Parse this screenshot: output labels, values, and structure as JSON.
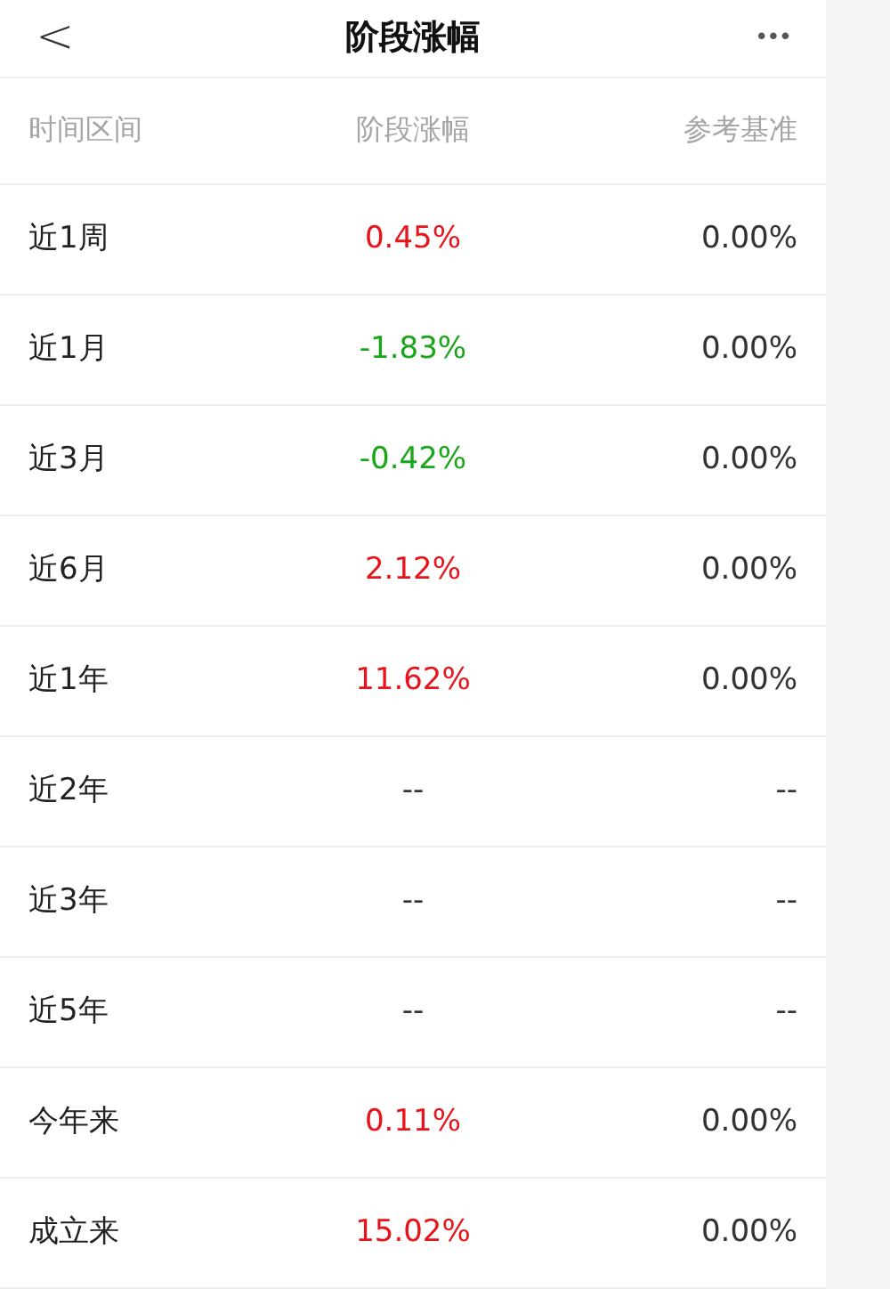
{
  "header": {
    "title": "阶段涨幅",
    "back_icon": "<",
    "more_icon": "•••"
  },
  "table": {
    "columns": [
      "时间区间",
      "阶段涨幅",
      "参考基准"
    ],
    "rows": [
      {
        "period": "近1周",
        "change": "0.45%",
        "color": "#e8141b",
        "benchmark": "0.00%"
      },
      {
        "period": "近1月",
        "change": "-1.83%",
        "color": "#1aa61a",
        "benchmark": "0.00%"
      },
      {
        "period": "近3月",
        "change": "-0.42%",
        "color": "#1aa61a",
        "benchmark": "0.00%"
      },
      {
        "period": "近6月",
        "change": "2.12%",
        "color": "#e8141b",
        "benchmark": "0.00%"
      },
      {
        "period": "近1年",
        "change": "11.62%",
        "color": "#e8141b",
        "benchmark": "0.00%"
      },
      {
        "period": "近2年",
        "change": "--",
        "color": "#333333",
        "benchmark": "--"
      },
      {
        "period": "近3年",
        "change": "--",
        "color": "#333333",
        "benchmark": "--"
      },
      {
        "period": "近5年",
        "change": "--",
        "color": "#333333",
        "benchmark": "--"
      },
      {
        "period": "今年来",
        "change": "0.11%",
        "color": "#e8141b",
        "benchmark": "0.00%"
      },
      {
        "period": "成立来",
        "change": "15.02%",
        "color": "#e8141b",
        "benchmark": "0.00%"
      }
    ]
  }
}
